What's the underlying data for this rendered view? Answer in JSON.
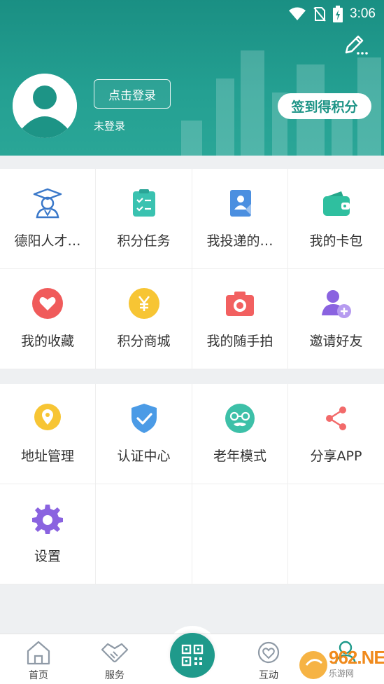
{
  "status_bar": {
    "time": "3:06"
  },
  "profile": {
    "login_button": "点击登录",
    "login_status": "未登录",
    "checkin_button": "签到得积分"
  },
  "menu_group_1": [
    {
      "label": "德阳人才…",
      "icon": "graduate-icon",
      "color": "#3a78c9"
    },
    {
      "label": "积分任务",
      "icon": "clipboard-icon",
      "color": "#3ac2b0"
    },
    {
      "label": "我投递的…",
      "icon": "resume-icon",
      "color": "#4b8fe0"
    },
    {
      "label": "我的卡包",
      "icon": "wallet-icon",
      "color": "#2fbf9f"
    },
    {
      "label": "我的收藏",
      "icon": "heart-icon",
      "color": "#f05b5b"
    },
    {
      "label": "积分商城",
      "icon": "yen-coin-icon",
      "color": "#f7c534"
    },
    {
      "label": "我的随手拍",
      "icon": "camera-icon",
      "color": "#f26060"
    },
    {
      "label": "邀请好友",
      "icon": "add-user-icon",
      "color": "#8a63e0"
    }
  ],
  "menu_group_2": [
    {
      "label": "地址管理",
      "icon": "location-icon",
      "color": "#f7c534"
    },
    {
      "label": "认证中心",
      "icon": "shield-check-icon",
      "color": "#4b9be6"
    },
    {
      "label": "老年模式",
      "icon": "elder-face-icon",
      "color": "#3dc0a8"
    },
    {
      "label": "分享APP",
      "icon": "share-icon",
      "color": "#f26a6a"
    },
    {
      "label": "设置",
      "icon": "gear-icon",
      "color": "#8a63e0"
    }
  ],
  "tabbar": {
    "home": "首页",
    "service": "服务",
    "interact": "互动"
  },
  "watermark": {
    "text": "962.NET",
    "sub": "乐游网"
  }
}
